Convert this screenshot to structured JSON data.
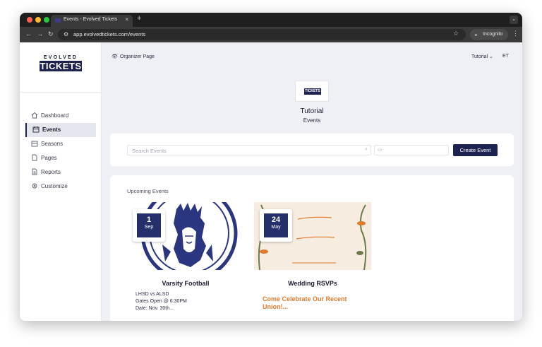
{
  "browser": {
    "tab_title": "Events - Evolved Tickets",
    "url": "app.evolvedtickets.com/events",
    "incognito_label": "Incognito",
    "colors": {
      "dot_red": "#ff5f57",
      "dot_yellow": "#febc2e",
      "dot_green": "#28c840"
    }
  },
  "brand": {
    "logo_top": "EVOLVED",
    "logo_main": "TICKETS",
    "center_logo_text": "TICKETS",
    "accent": "#1d2350"
  },
  "sidebar": {
    "items": [
      {
        "label": "Dashboard",
        "icon": "home-icon"
      },
      {
        "label": "Events",
        "icon": "calendar-icon",
        "active": true
      },
      {
        "label": "Seasons",
        "icon": "calendar-icon"
      },
      {
        "label": "Pages",
        "icon": "document-icon"
      },
      {
        "label": "Reports",
        "icon": "report-icon"
      },
      {
        "label": "Customize",
        "icon": "gear-icon"
      }
    ]
  },
  "header": {
    "organizer_page": "Organizer Page",
    "tutorial_menu": "Tutorial",
    "avatar_initials": "ET"
  },
  "org": {
    "name": "Tutorial",
    "subtitle": "Events"
  },
  "search": {
    "placeholder": "Search Events",
    "create_button": "Create Event"
  },
  "upcoming": {
    "title": "Upcoming Events",
    "events": [
      {
        "day": "1",
        "month": "Sep",
        "title": "Varsity Football",
        "desc_lines": [
          "LHSD vs ALSD",
          "Gates Open @ 6:30PM",
          "Date: Nov. 30th..."
        ]
      },
      {
        "day": "24",
        "month": "May",
        "title": "Wedding RSVPs",
        "highlight": "Come Celebrate Our Recent Union!..."
      }
    ]
  }
}
